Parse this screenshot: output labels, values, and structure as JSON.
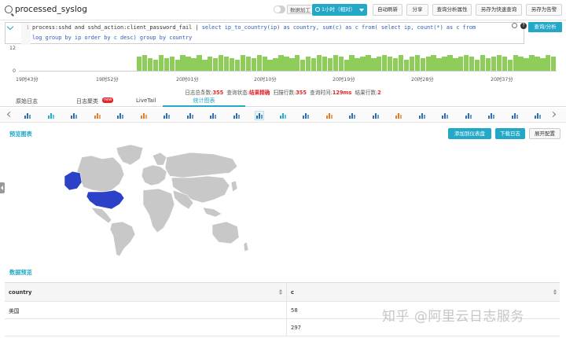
{
  "header": {
    "logstore_title": "processed_syslog",
    "toggle_label": "数据加工",
    "time_range": "1小时（相对）",
    "buttons": [
      "自动刷新",
      "分享",
      "查询分析属性",
      "另存为快速查询",
      "另存为告警"
    ]
  },
  "query": {
    "line_numbers": [
      "1",
      ""
    ],
    "line1_plain": "process:sshd and sshd_action:client_password_fail",
    "line1_sep": " | ",
    "line1_sql": "select ip_to_country(ip) as country, sum(c) as c from( select ip, count(*) as c from",
    "line2_sql": "log group by ip order by c desc) group by country",
    "search_button": "查询/分析"
  },
  "histogram": {
    "y_max_label": "12",
    "y_min_label": "0",
    "time_ticks": [
      "19时43分",
      "19时52分",
      "20时01分",
      "20时10分",
      "20时19分",
      "20时28分",
      "20时37分"
    ],
    "values": [
      9,
      10,
      8,
      7,
      10,
      8,
      9,
      7,
      10,
      9,
      8,
      10,
      7,
      9,
      8,
      10,
      9,
      8,
      7,
      10,
      9,
      8,
      10,
      9,
      7,
      8,
      10,
      9,
      8,
      10,
      7,
      9,
      8,
      10,
      9,
      8,
      10,
      9,
      7,
      10,
      8,
      9,
      10,
      8,
      9,
      10,
      9,
      8,
      10,
      7,
      9,
      10,
      8,
      9,
      10,
      8,
      9,
      10,
      8,
      9,
      10,
      9,
      7,
      10,
      8,
      9,
      10,
      9,
      7,
      10,
      9,
      8,
      10,
      9,
      8,
      10,
      9
    ]
  },
  "status": {
    "total_label": "日志总条数:",
    "total_value": "355",
    "state_label": "查询状态:",
    "state_value": "结果精确",
    "scanned_label": "扫描行数:",
    "scanned_value": "355",
    "time_label": "查询时间:",
    "time_value": "129ms",
    "rows_label": "结果行数:",
    "rows_value": "2"
  },
  "tabs": {
    "raw_logs": "原始日志",
    "log_clustering": "日志聚类",
    "new_badge": "new",
    "livetail": "LiveTail",
    "stat_chart": "统计图表"
  },
  "chart_types": [
    "table-icon",
    "line-chart-icon",
    "bar-chart-icon",
    "row-bar-icon",
    "pie-chart-icon",
    "area-chart-icon",
    "single-value-icon",
    "progress-bar-icon",
    "word-icon",
    "china-map-icon",
    "world-map-icon",
    "amap-icon",
    "flow-chart-icon",
    "sankey-icon",
    "bubble-icon",
    "word-cloud-icon",
    "funnel-icon",
    "treemap-icon",
    "radar-icon",
    "timeline-icon",
    "heatmap-icon",
    "tree-icon",
    "dashboard-icon"
  ],
  "preview": {
    "title": "预览图表",
    "add_dashboard": "添加到仪表盘",
    "download_log": "下载日志",
    "expand_config": "展开配置",
    "highlight_color": "#2a41c8",
    "land_color": "#c8c8c8"
  },
  "data_preview": {
    "title": "数据预览",
    "columns": [
      "country",
      "c"
    ],
    "rows": [
      [
        "美国",
        "58"
      ],
      [
        "",
        "297"
      ]
    ]
  },
  "chart_data": {
    "type": "map",
    "categories": [
      "美国",
      ""
    ],
    "values": [
      58,
      297
    ],
    "title": "",
    "xlabel": "",
    "ylabel": ""
  },
  "watermark": "知乎 @阿里云日志服务"
}
